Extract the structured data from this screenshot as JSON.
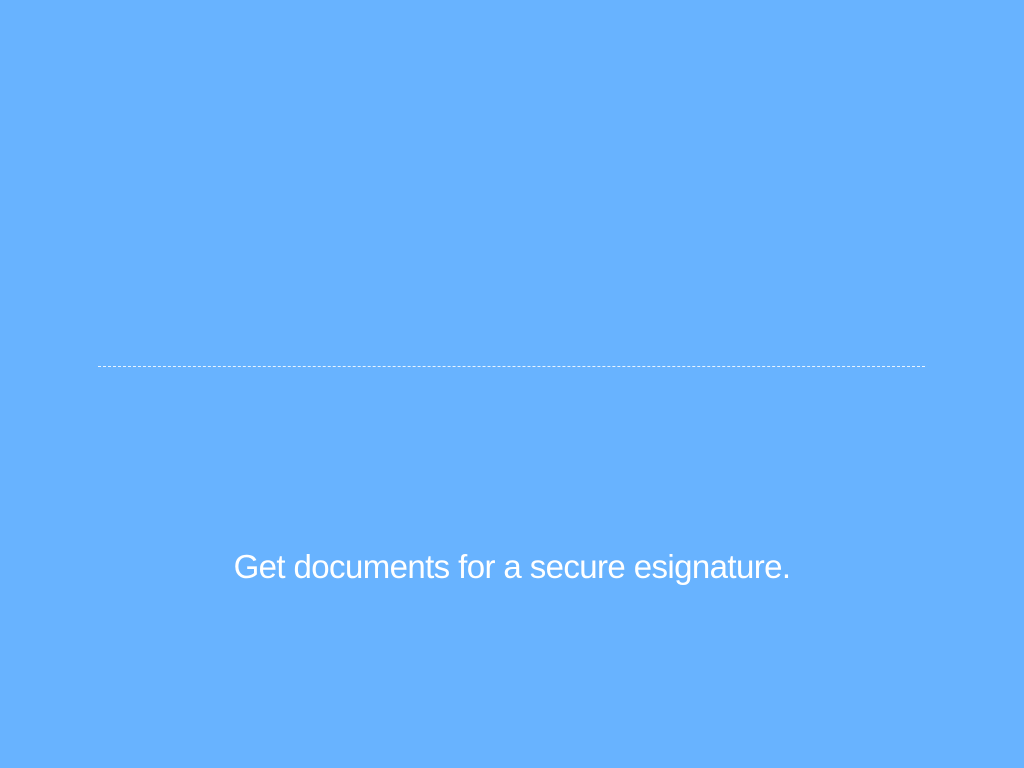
{
  "screen": {
    "background_color": "#68b3ff",
    "text_color": "#ffffff",
    "signature_line_style": "dashed"
  },
  "tagline": {
    "text": "Get documents for a secure esignature."
  }
}
